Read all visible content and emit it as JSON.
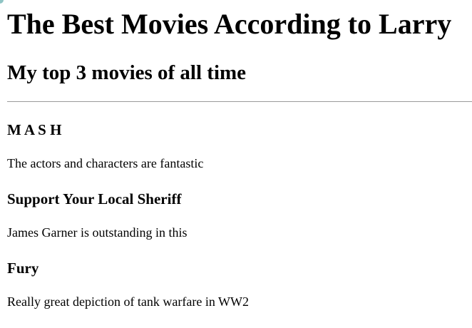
{
  "page": {
    "title": "The Best Movies According to Larry",
    "subtitle": "My top 3 movies of all time"
  },
  "movies": [
    {
      "title": "M A S H",
      "description": "The actors and characters are fantastic"
    },
    {
      "title": "Support Your Local Sheriff",
      "description": "James Garner is outstanding in this"
    },
    {
      "title": "Fury",
      "description": "Really great depiction of tank warfare in WW2"
    }
  ]
}
